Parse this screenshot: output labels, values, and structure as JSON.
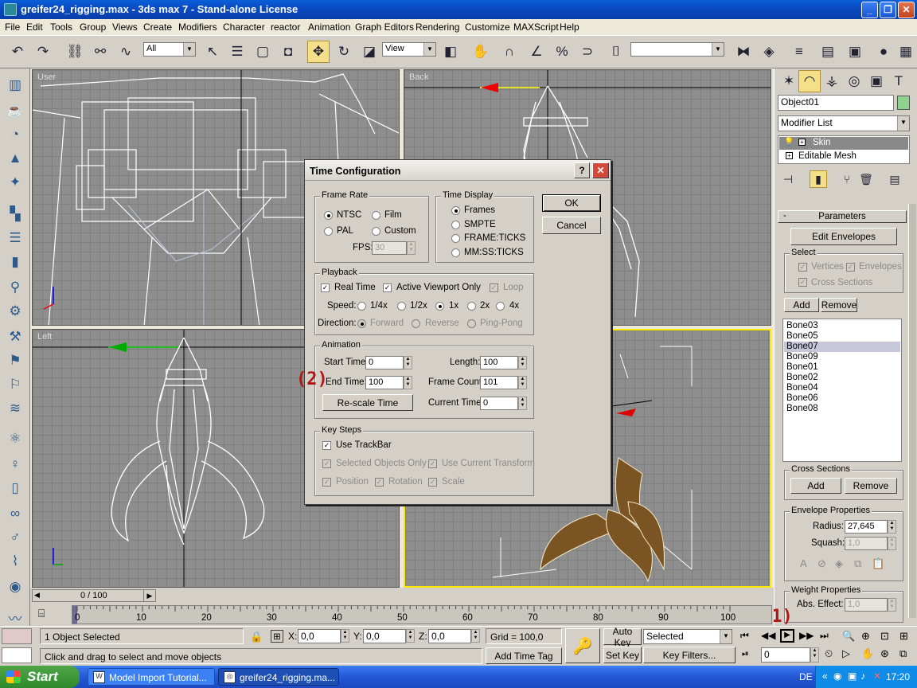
{
  "window": {
    "title": "greifer24_rigging.max - 3ds max 7  - Stand-alone License",
    "min": "_",
    "max": "❐",
    "close": "✕"
  },
  "menu": [
    "File",
    "Edit",
    "Tools",
    "Group",
    "Views",
    "Create",
    "Modifiers",
    "Character",
    "reactor",
    "Animation",
    "Graph Editors",
    "Rendering",
    "Customize",
    "MAXScript",
    "Help"
  ],
  "toolbar": {
    "selection_filter": "All",
    "ref_coord": "View"
  },
  "viewports": {
    "user": "User",
    "back": "Back",
    "left": "Left"
  },
  "command_panel": {
    "object_name": "Object01",
    "modifier_list": "Modifier List",
    "stack": [
      {
        "label": "Skin"
      },
      {
        "label": "Editable Mesh"
      }
    ],
    "parameters_title": "Parameters",
    "edit_envelopes": "Edit Envelopes",
    "select_group": "Select",
    "vertices": "Vertices",
    "envelopes": "Envelopes",
    "cross_sections_cb": "Cross Sections",
    "add": "Add",
    "remove": "Remove",
    "bones": [
      "Bone03",
      "Bone05",
      "Bone07",
      "Bone09",
      "Bone01",
      "Bone02",
      "Bone04",
      "Bone06",
      "Bone08"
    ],
    "selected_bone": "Bone07",
    "cross_sections_group": "Cross Sections",
    "cs_add": "Add",
    "cs_remove": "Remove",
    "envelope_props": "Envelope Properties",
    "radius_label": "Radius:",
    "radius_value": "27,645",
    "squash_label": "Squash:",
    "squash_value": "1,0",
    "weight_props": "Weight Properties",
    "abs_effect_label": "Abs. Effect:",
    "abs_effect_value": "1,0"
  },
  "dialog": {
    "title": "Time Configuration",
    "help": "?",
    "close": "✕",
    "ok": "OK",
    "cancel": "Cancel",
    "frame_rate": {
      "label": "Frame Rate",
      "ntsc": "NTSC",
      "film": "Film",
      "pal": "PAL",
      "custom": "Custom",
      "fps_label": "FPS:",
      "fps_value": "30"
    },
    "time_display": {
      "label": "Time Display",
      "frames": "Frames",
      "smpte": "SMPTE",
      "frame_ticks": "FRAME:TICKS",
      "mmss": "MM:SS:TICKS"
    },
    "playback": {
      "label": "Playback",
      "real_time": "Real Time",
      "active_viewport": "Active Viewport Only",
      "loop": "Loop",
      "speed_label": "Speed:",
      "speeds": [
        "1/4x",
        "1/2x",
        "1x",
        "2x",
        "4x"
      ],
      "direction_label": "Direction:",
      "forward": "Forward",
      "reverse": "Reverse",
      "pingpong": "Ping-Pong"
    },
    "animation": {
      "label": "Animation",
      "start_label": "Start Time:",
      "start_value": "0",
      "end_label": "End Time:",
      "end_value": "100",
      "length_label": "Length:",
      "length_value": "100",
      "count_label": "Frame Count:",
      "count_value": "101",
      "rescale": "Re-scale Time",
      "current_label": "Current Time:",
      "current_value": "0"
    },
    "key_steps": {
      "label": "Key Steps",
      "use_trackbar": "Use TrackBar",
      "selected_only": "Selected Objects Only",
      "use_current": "Use Current Transform",
      "position": "Position",
      "rotation": "Rotation",
      "scale": "Scale"
    }
  },
  "annotations": {
    "one": "(1)",
    "two": "(2)"
  },
  "timeline": {
    "slider": "0 / 100",
    "ticks": [
      "0",
      "10",
      "20",
      "30",
      "40",
      "50",
      "60",
      "70",
      "80",
      "90",
      "100"
    ]
  },
  "status": {
    "selected": "1 Object Selected",
    "prompt": "Click and drag to select and move objects",
    "x_label": "X:",
    "x_value": "0,0",
    "y_label": "Y:",
    "y_value": "0,0",
    "z_label": "Z:",
    "z_value": "0,0",
    "grid": "Grid = 100,0",
    "add_time_tag": "Add Time Tag",
    "auto_key": "Auto Key",
    "set_key": "Set Key",
    "key_mode": "Selected",
    "key_filters": "Key Filters...",
    "frame": "0"
  },
  "taskbar": {
    "start": "Start",
    "tasks": [
      "Model Import Tutorial...",
      "greifer24_rigging.ma..."
    ],
    "lang": "DE",
    "clock": "17:20"
  }
}
